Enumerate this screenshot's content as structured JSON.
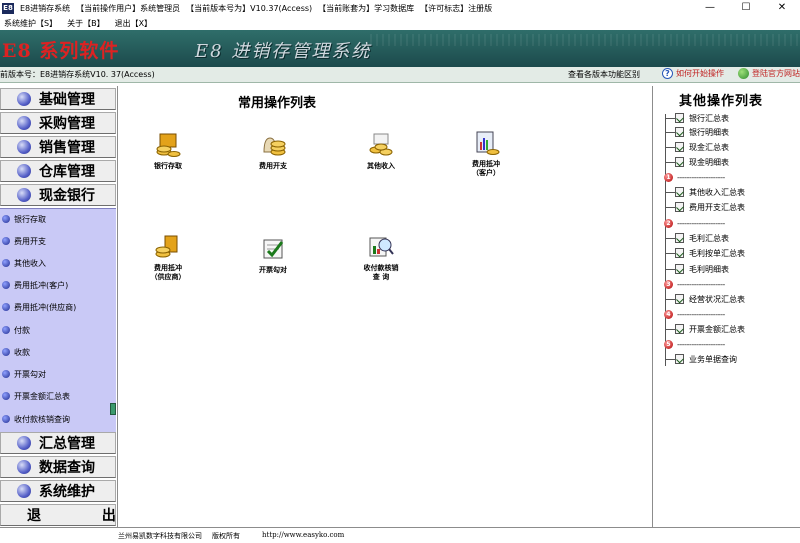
{
  "window": {
    "app_icon": "E8",
    "title_items": [
      "E8进销存系统",
      "【当前操作用户】系统管理员",
      "【当前版本号为】V10.37(Access)",
      "【当前账套为】学习数据库",
      "【许可标志】注册版"
    ],
    "min_symbol": "—",
    "max_symbol": "☐",
    "close_symbol": "✕"
  },
  "menu": {
    "items": [
      "系统维护【S】",
      "关于【B】",
      "退出【X】"
    ]
  },
  "banner": {
    "logo": "E8 系列软件",
    "system_title": "E8 进销存管理系统"
  },
  "version_bar": {
    "version_text": "前版本号：E8进销存系统V10. 37(Access)",
    "compare_text": "查看各版本功能区别",
    "howto_text": "如何开始操作",
    "site_text": "登陆官方网站"
  },
  "left_nav": {
    "top_items": [
      "基础管理",
      "采购管理",
      "销售管理",
      "仓库管理",
      "现金银行"
    ],
    "sub_items": [
      "银行存取",
      "费用开支",
      "其他收入",
      "费用抵冲(客户)",
      "费用抵冲(供应商)",
      "付款",
      "收款",
      "开票勾对",
      "开票金额汇总表",
      "收付款核销查询"
    ],
    "bottom_items": [
      "汇总管理",
      "数据查询",
      "系统维护",
      "退 出"
    ]
  },
  "center": {
    "title": "常用操作列表",
    "operations": [
      {
        "label": "银行存取",
        "icon": "bank-deposit-icon"
      },
      {
        "label": "费用开支",
        "icon": "expense-icon"
      },
      {
        "label": "其他收入",
        "icon": "other-income-icon"
      },
      {
        "label": "费用抵冲\n（客户）",
        "icon": "expense-offset-customer-icon"
      },
      {
        "label": "费用抵冲\n（供应商）",
        "icon": "expense-offset-supplier-icon"
      },
      {
        "label": "开票勾对",
        "icon": "invoice-check-icon"
      },
      {
        "label": "收付款核销\n查  询",
        "icon": "payment-writeoff-query-icon"
      }
    ]
  },
  "right": {
    "title": "其他操作列表",
    "groups": [
      {
        "items": [
          "银行汇总表",
          "银行明细表",
          "现金汇总表",
          "现金明细表"
        ]
      },
      {
        "num": "1",
        "items": [
          "其他收入汇总表",
          "费用开支汇总表"
        ]
      },
      {
        "num": "2",
        "items": [
          "毛利汇总表",
          "毛利按单汇总表",
          "毛利明细表"
        ]
      },
      {
        "num": "3",
        "items": [
          "经营状况汇总表"
        ]
      },
      {
        "num": "4",
        "items": [
          "开票金额汇总表"
        ]
      },
      {
        "num": "5",
        "items": [
          "业务单据查询"
        ]
      }
    ],
    "separator_dashes": "--------------------"
  },
  "footer": {
    "company": "兰州易凯数字科技有限公司",
    "rights": "版权所有",
    "url": "http://www.easyko.com"
  }
}
